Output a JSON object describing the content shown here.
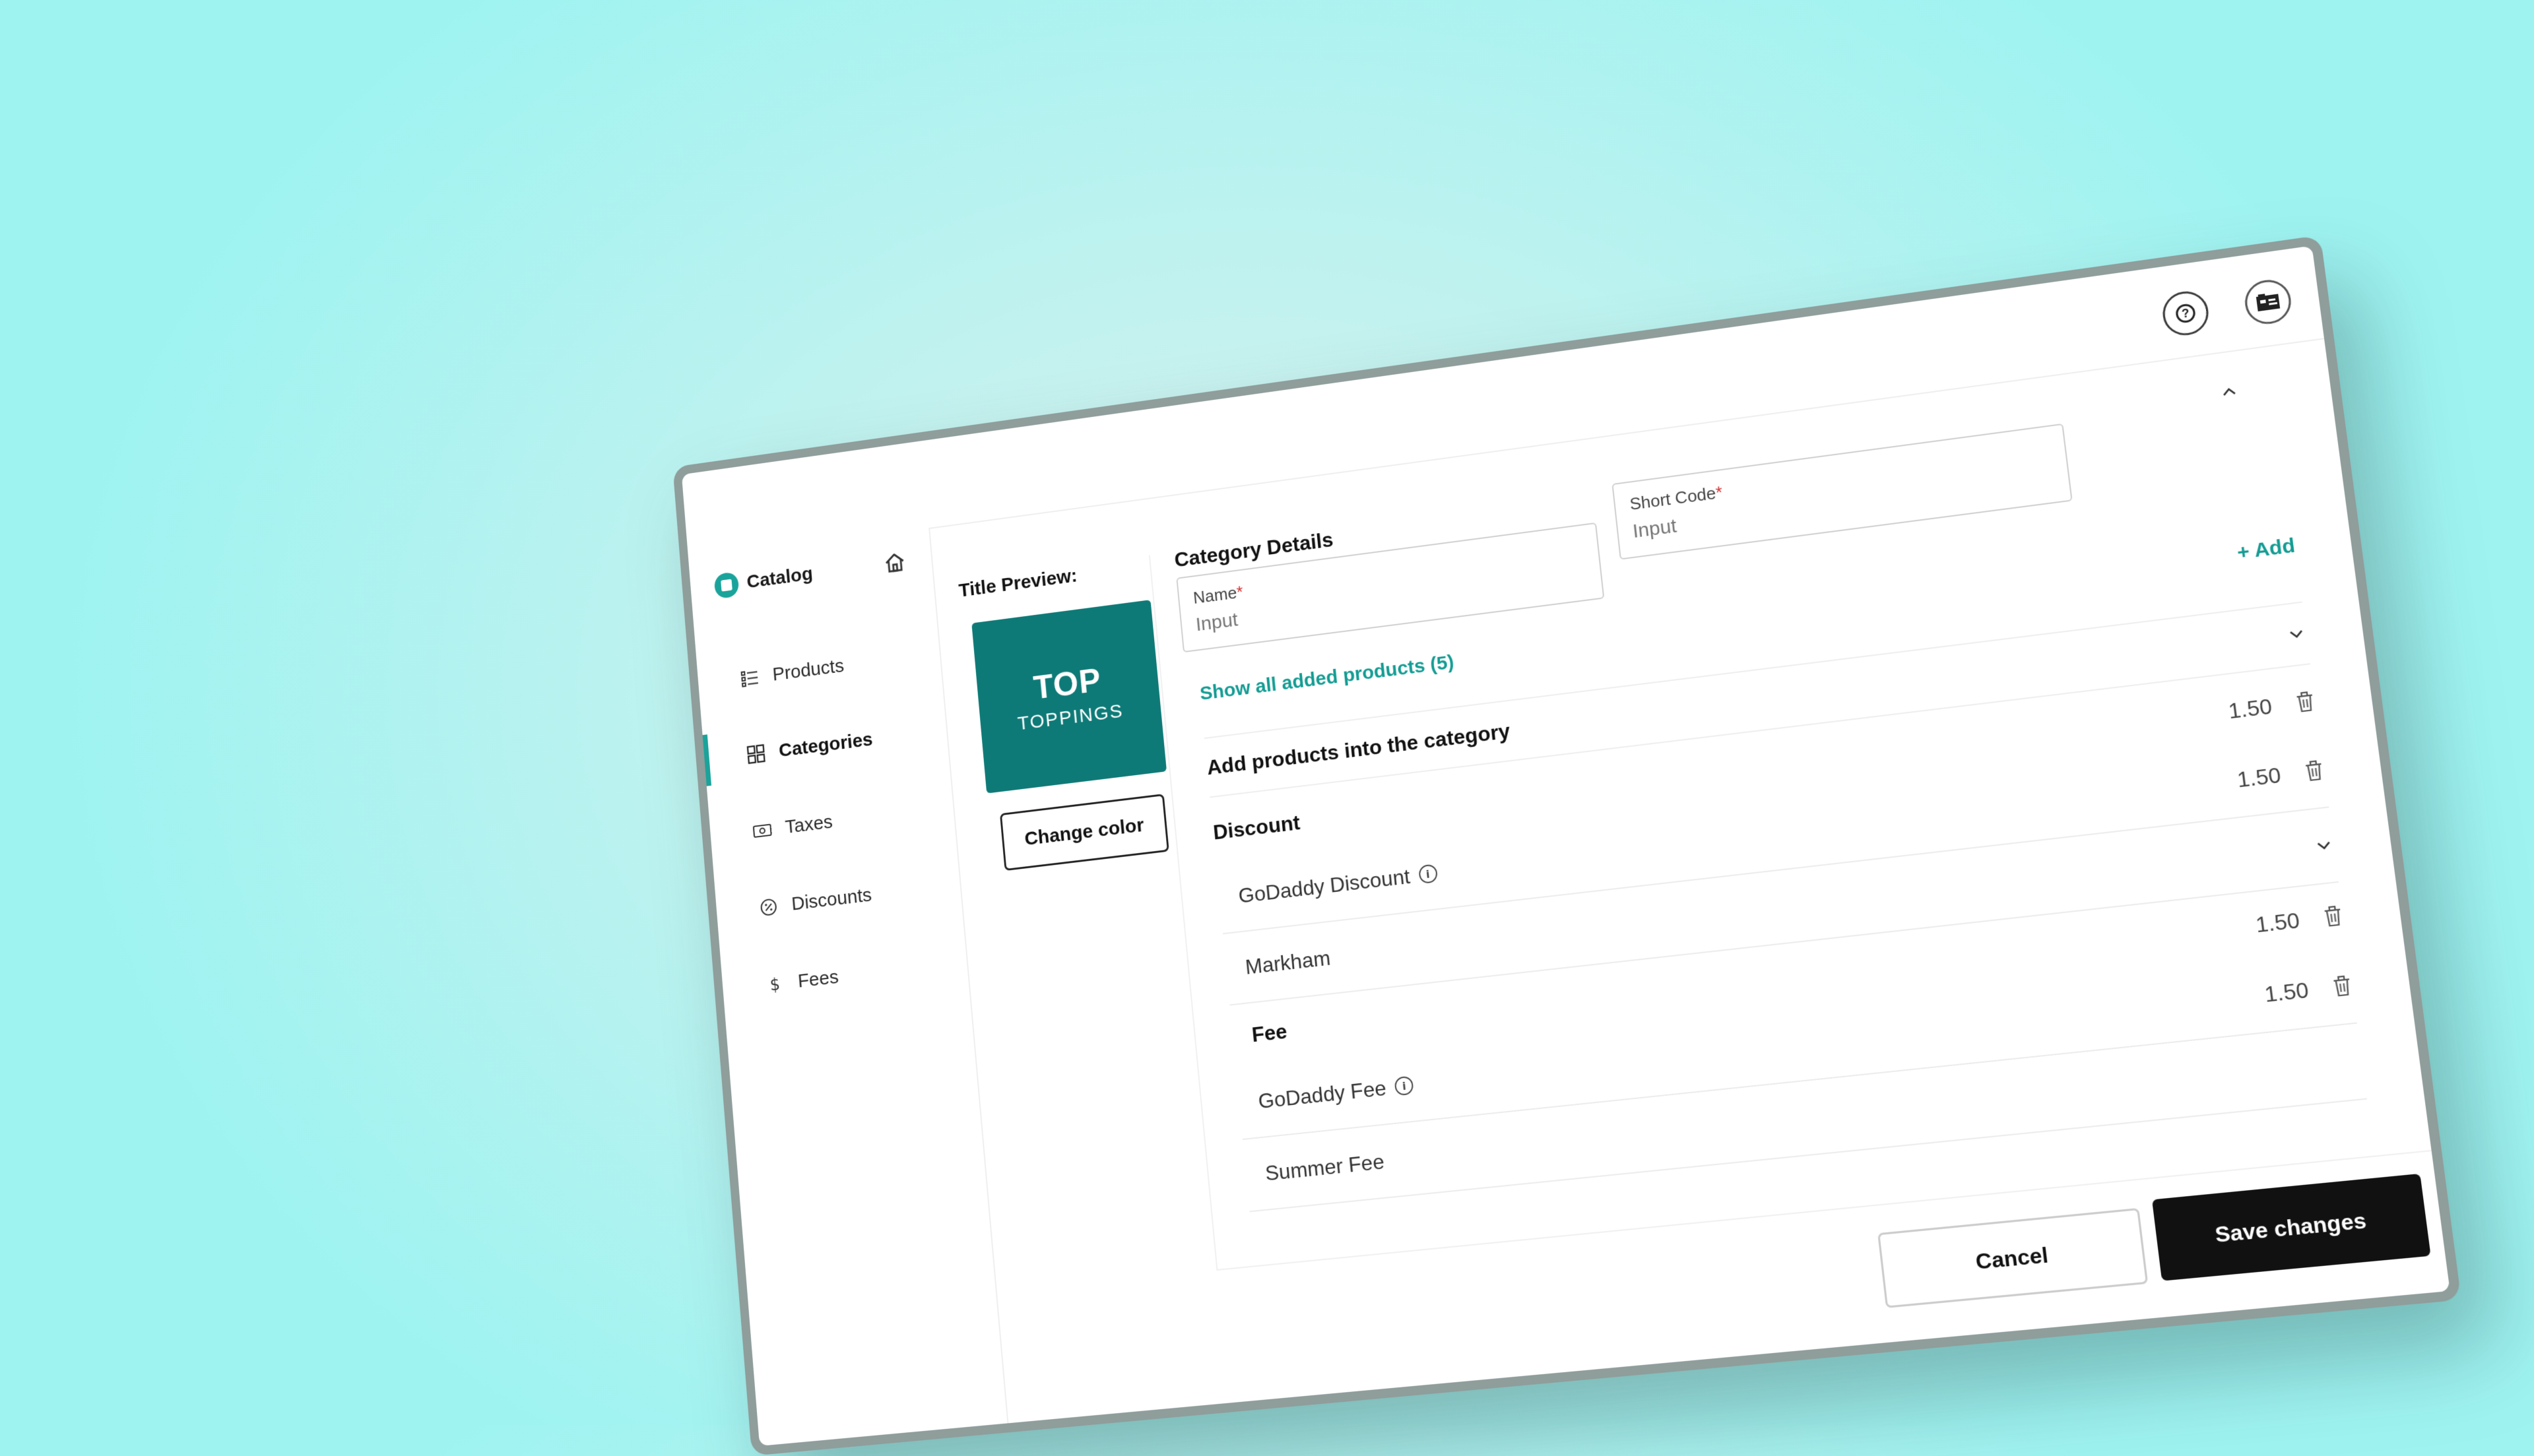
{
  "sidebar": {
    "brand": "Catalog",
    "items": [
      {
        "label": "Products",
        "icon": "list-icon"
      },
      {
        "label": "Categories",
        "icon": "grid-icon",
        "active": true
      },
      {
        "label": "Taxes",
        "icon": "cash-icon"
      },
      {
        "label": "Discounts",
        "icon": "discount-icon"
      },
      {
        "label": "Fees",
        "icon": "dollar-icon"
      }
    ]
  },
  "preview": {
    "title": "Title Preview:",
    "tile_main": "TOP",
    "tile_sub": "TOPPINGS",
    "tile_color": "#0e7a77",
    "change_color_label": "Change color"
  },
  "details": {
    "title": "Category Details",
    "name_label": "Name",
    "name_placeholder": "Input",
    "code_label": "Short Code",
    "code_placeholder": "Input",
    "required_mark": "*",
    "show_all": "Show all added products (5)",
    "add_label": "+ Add",
    "section_title": "Add products into the category"
  },
  "rows": [
    {
      "name": "Discount",
      "value": "1.50",
      "group": true
    },
    {
      "name": "GoDaddy Discount",
      "value": "1.50",
      "info": true
    },
    {
      "name": "Markham",
      "chevron": true
    },
    {
      "name": "Fee",
      "value": "1.50",
      "group": true
    },
    {
      "name": "GoDaddy Fee",
      "value": "1.50",
      "info": true
    },
    {
      "name": "Summer Fee"
    }
  ],
  "footer": {
    "cancel_label": "Cancel",
    "save_label": "Save changes"
  },
  "colors": {
    "accent": "#1aa39a",
    "primary_button": "#111111"
  }
}
